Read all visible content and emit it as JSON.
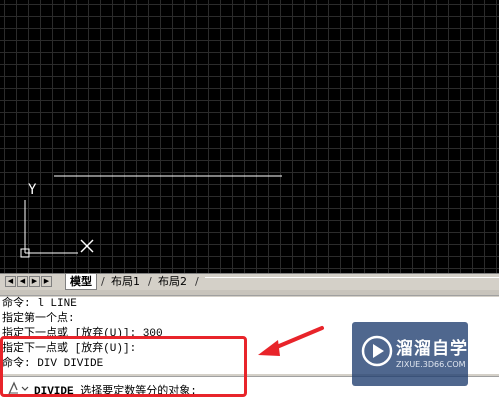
{
  "canvas": {
    "ucs_y_label": "Y"
  },
  "tabs": {
    "items": [
      {
        "label": "模型",
        "active": true
      },
      {
        "label": "布局1",
        "active": false
      },
      {
        "label": "布局2",
        "active": false
      }
    ]
  },
  "command": {
    "history": [
      "命令: l LINE",
      "指定第一个点:",
      "指定下一点或 [放弃(U)]: 300",
      "指定下一点或 [放弃(U)]:",
      "命令: DIV DIVIDE"
    ],
    "prompt_keyword": "DIVIDE",
    "prompt_text": "选择要定数等分的对象:"
  },
  "watermark": {
    "title": "溜溜自学",
    "url": "ZIXUE.3D66.COM"
  },
  "colors": {
    "annotation": "#e8242a",
    "canvas_bg": "#000000",
    "grid": "#2b2b2b"
  }
}
